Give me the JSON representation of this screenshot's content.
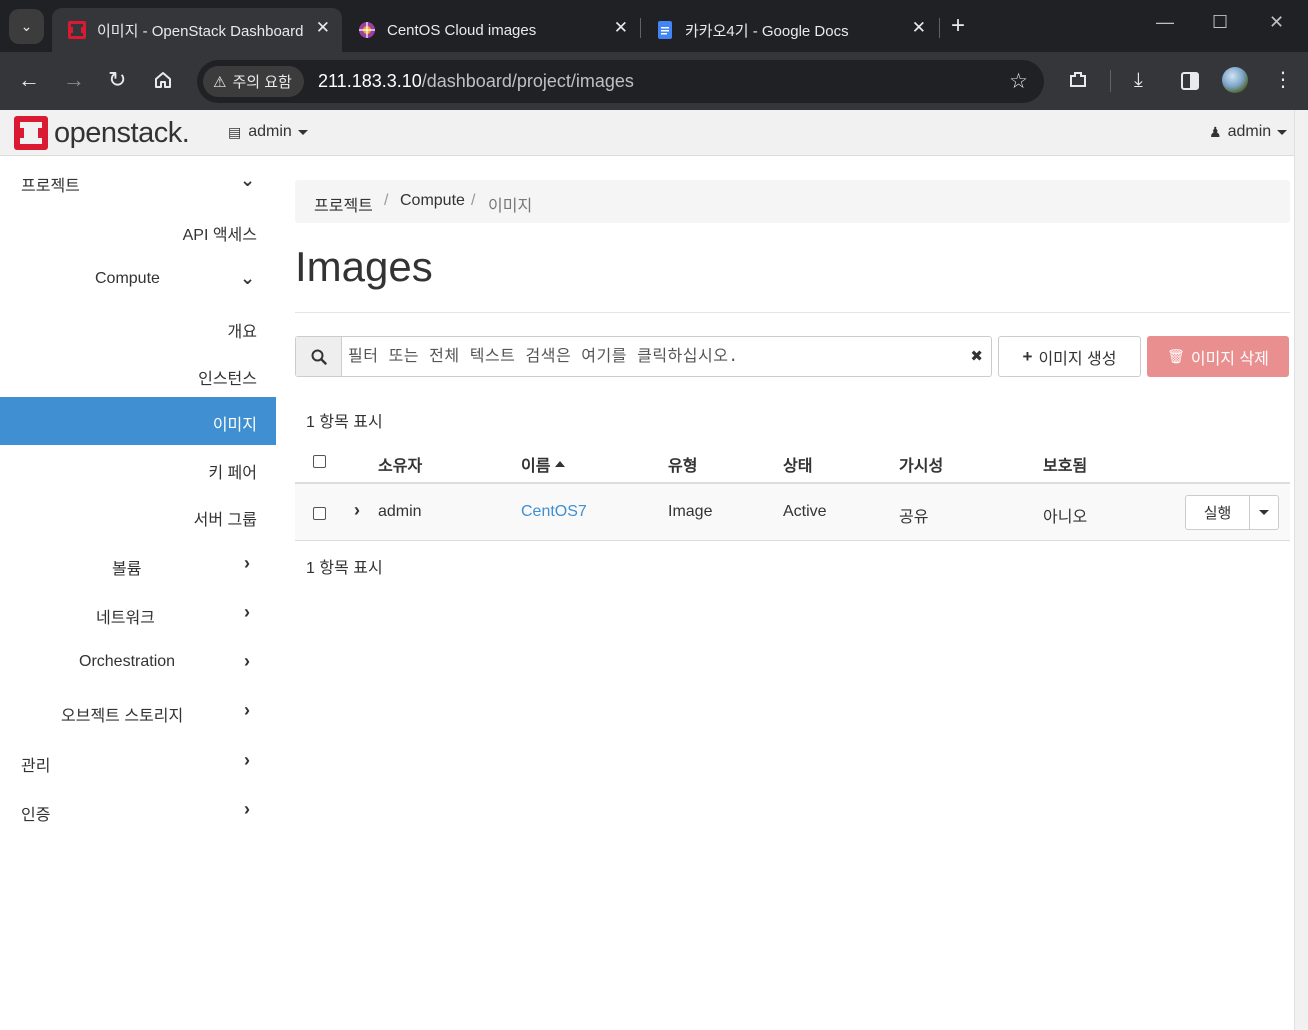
{
  "browser": {
    "tabs": [
      {
        "title": "이미지 - OpenStack Dashboard",
        "favicon": "openstack-favicon",
        "active": true
      },
      {
        "title": "CentOS Cloud images",
        "favicon": "centos-favicon",
        "active": false
      },
      {
        "title": "카카오4기 - Google Docs",
        "favicon": "google-docs-favicon",
        "active": false
      }
    ],
    "security_label": "주의 요함",
    "url_host": "211.183.3.10",
    "url_path": "/dashboard/project/images"
  },
  "header": {
    "logo_text": "openstack.",
    "project_selector": "admin",
    "user_menu": "admin"
  },
  "sidebar": {
    "items": [
      {
        "label": "프로젝트",
        "chevron": "down"
      },
      {
        "label": "API 액세스"
      },
      {
        "label": "Compute",
        "chevron": "down"
      },
      {
        "label": "개요"
      },
      {
        "label": "인스턴스"
      },
      {
        "label": "이미지",
        "active": true
      },
      {
        "label": "키 페어"
      },
      {
        "label": "서버 그룹"
      },
      {
        "label": "볼륨",
        "chevron": "right"
      },
      {
        "label": "네트워크",
        "chevron": "right"
      },
      {
        "label": "Orchestration",
        "chevron": "right"
      },
      {
        "label": "오브젝트 스토리지",
        "chevron": "right"
      },
      {
        "label": "관리",
        "chevron": "right"
      },
      {
        "label": "인증",
        "chevron": "right"
      }
    ]
  },
  "breadcrumb": [
    "프로젝트",
    "Compute",
    "이미지"
  ],
  "page_title": "Images",
  "filter": {
    "placeholder": "필터 또는 전체 텍스트 검색은 여기를 클릭하십시오."
  },
  "actions": {
    "create_label": "이미지 생성",
    "delete_label": "이미지 삭제"
  },
  "table": {
    "count_text": "1 항목 표시",
    "columns": [
      "소유자",
      "이름",
      "유형",
      "상태",
      "가시성",
      "보호됨"
    ],
    "rows": [
      {
        "owner": "admin",
        "name": "CentOS7",
        "type": "Image",
        "status": "Active",
        "visibility": "공유",
        "protected": "아니오",
        "action": "실행"
      }
    ]
  },
  "colors": {
    "accent": "#3f8fd2",
    "danger_disabled": "#e98a8a",
    "brand_red": "#da1a32"
  }
}
